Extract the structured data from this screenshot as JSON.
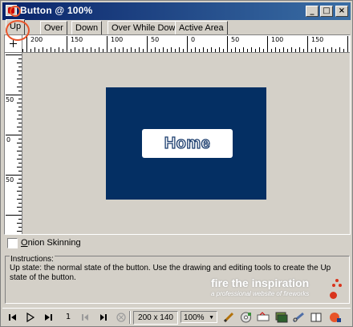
{
  "window": {
    "title": "Button @ 100%",
    "minimize_label": "_",
    "maximize_label": "□",
    "close_label": "×"
  },
  "tabs": [
    {
      "label": "Up",
      "active": true
    },
    {
      "label": "Over",
      "active": false
    },
    {
      "label": "Down",
      "active": false
    },
    {
      "label": "Over While Down",
      "active": false
    },
    {
      "label": "Active Area",
      "active": false
    }
  ],
  "rulers": {
    "horizontal_labels": [
      "200",
      "150",
      "100",
      "50",
      "0",
      "50",
      "100",
      "150"
    ],
    "vertical_labels": [
      "50",
      "0",
      "50"
    ]
  },
  "canvas": {
    "button_text": "Home",
    "button_bg": "#042f63",
    "button_size": "200 x 140"
  },
  "options": {
    "onion_label": "Onion Skinning",
    "onion_checked": false
  },
  "instructions": {
    "title": "Instructions:",
    "text": "Up state: the normal state of the button. Use the drawing and editing tools to create the Up state of the button."
  },
  "watermark": {
    "line1": "fire the inspiration",
    "line2": "a professional website of fireworks"
  },
  "toolbar": {
    "frame_number": "1",
    "size": "200 x 140",
    "zoom": "100%",
    "icons": [
      "first-frame-icon",
      "play-icon",
      "last-frame-icon",
      "prev-frame-icon",
      "next-frame-icon",
      "stop-icon",
      "pencil-icon",
      "cd-icon",
      "export-icon",
      "layers-icon",
      "link-icon",
      "book-icon"
    ]
  }
}
